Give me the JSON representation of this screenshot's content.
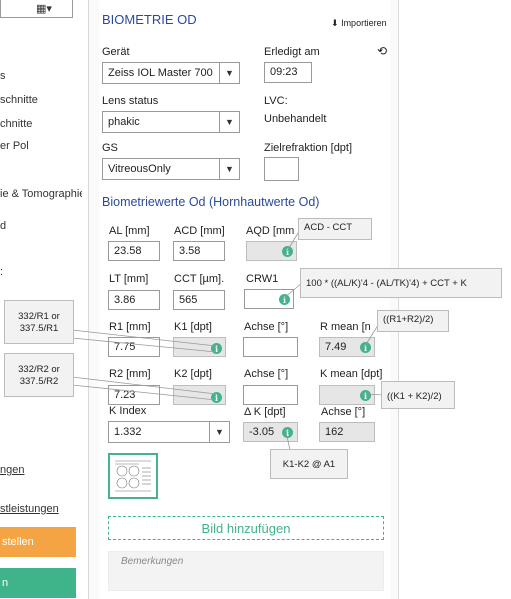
{
  "sidebar": {
    "items": [
      "s",
      "schnitte",
      "chnitte",
      "er Pol",
      "ie & Tomographie",
      "d",
      ":"
    ],
    "links": [
      "ngen",
      "stleistungen"
    ],
    "buttons": [
      "stellen",
      "n"
    ],
    "colors": {
      "orange": "#f5a444",
      "green": "#3fb48b"
    }
  },
  "panel": {
    "title": "BIOMETRIE OD",
    "import_label": "Importieren",
    "device_label": "Gerät",
    "device_value": "Zeiss IOL Master 700",
    "done_label": "Erledigt am",
    "done_value": "09:23",
    "lens_label": "Lens status",
    "lens_value": "phakic",
    "lvc_label": "LVC:",
    "lvc_value": "Unbehandelt",
    "gs_label": "GS",
    "gs_value": "VitreousOnly",
    "target_label": "Zielrefraktion [dpt]",
    "target_value": "",
    "section_title": "Biometriewerte Od (Hornhautwerte Od)",
    "al_label": "AL [mm]",
    "al_value": "23.58",
    "acd_label": "ACD [mm]",
    "acd_value": "3.58",
    "aqd_label": "AQD [mm",
    "lt_label": "LT [mm]",
    "lt_value": "3.86",
    "cct_label": "CCT [µm].",
    "cct_value": "565",
    "crw_label": "CRW1",
    "r1_label": "R1 [mm]",
    "r1_value": "7.75",
    "k1_label": "K1 [dpt]",
    "axis1_label": "Achse [°]",
    "rmean_label": "R mean [n",
    "rmean_value": "7.49",
    "r2_label": "R2 [mm]",
    "r2_value": "7.23",
    "k2_label": "K2 [dpt]",
    "axis2_label": "Achse [°]",
    "kmean_label": "K mean [dpt]",
    "kindex_label": "K Index",
    "kindex_value": "1.332",
    "dk_label": "Δ K [dpt]",
    "dk_value": "-3.05",
    "axis3_label": "Achse [°]",
    "axis3_value": "162",
    "add_image": "Bild hinzufügen",
    "notes_placeholder": "Bemerkungen"
  },
  "tooltips": {
    "aqd": "ACD - CCT",
    "crw": "100 * ((AL/K)'4 - (AL/TK)'4) + CCT  + K",
    "rmean": "((R1+R2)/2)",
    "kmean": "((K1 + K2)/2)",
    "dk": "K1-K2 @ A1",
    "k1a": "332/R1 or",
    "k1b": "337.5/R1",
    "k2a": "332/R2 or",
    "k2b": "337.5/R2"
  }
}
